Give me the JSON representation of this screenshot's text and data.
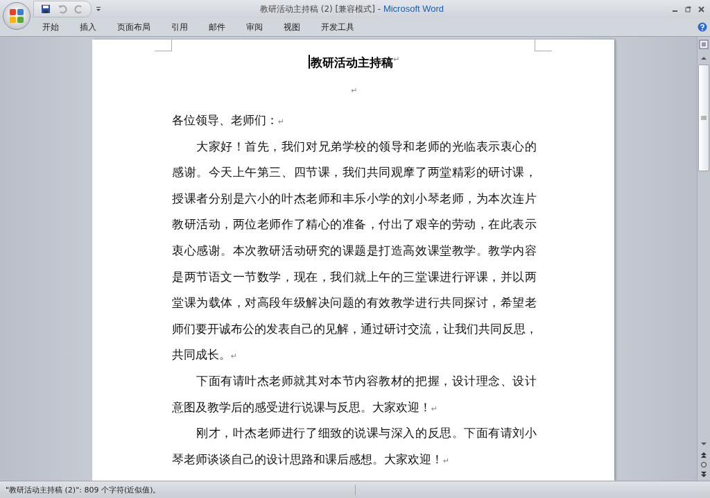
{
  "window": {
    "title": "教研活动主持稿 (2) [兼容模式]",
    "separator": "-",
    "app_name": "Microsoft Word"
  },
  "tabs": [
    {
      "label": "开始",
      "selected": false
    },
    {
      "label": "插入",
      "selected": false
    },
    {
      "label": "页面布局",
      "selected": false
    },
    {
      "label": "引用",
      "selected": false
    },
    {
      "label": "邮件",
      "selected": false
    },
    {
      "label": "审阅",
      "selected": false
    },
    {
      "label": "视图",
      "selected": false
    },
    {
      "label": "开发工具",
      "selected": false
    }
  ],
  "document": {
    "title": "教研活动主持稿",
    "paragraphs": [
      {
        "kind": "empty"
      },
      {
        "kind": "plain",
        "lines": [
          "各位领导、老师们："
        ]
      },
      {
        "kind": "indented",
        "lines": [
          "大家好！首先，我们对兄弟学校的领导和老师的光临表示衷心的",
          "感谢。今天上午第三、四节课，我们共同观摩了两堂精彩的研讨课，",
          "授课者分别是六小的叶杰老师和丰乐小学的刘小琴老师，为本次连片",
          "教研活动，两位老师作了精心的准备，付出了艰辛的劳动，在此表示",
          "衷心感谢。本次教研活动研究的课题是打造高效课堂教学。教学内容",
          "是两节语文一节数学，现在，我们就上午的三堂课进行评课，并以两",
          "堂课为载体，对高段年级解决问题的有效教学进行共同探讨，希望老",
          "师们要开诚布公的发表自己的见解，通过研讨交流，让我们共同反思，",
          "共同成长。"
        ]
      },
      {
        "kind": "indented",
        "lines": [
          "下面有请叶杰老师就其对本节内容教材的把握，设计理念、设计",
          "意图及教学后的感受进行说课与反思。大家欢迎！"
        ]
      },
      {
        "kind": "indented",
        "lines": [
          "刚才，叶杰老师进行了细致的说课与深入的反思。下面有请刘小",
          "琴老师谈谈自己的设计思路和课后感想。大家欢迎！"
        ]
      }
    ],
    "paragraph_mark": "↵"
  },
  "status_bar": {
    "text": "\"教研活动主持稿 (2)\": 809 个字符(近似值)。"
  }
}
